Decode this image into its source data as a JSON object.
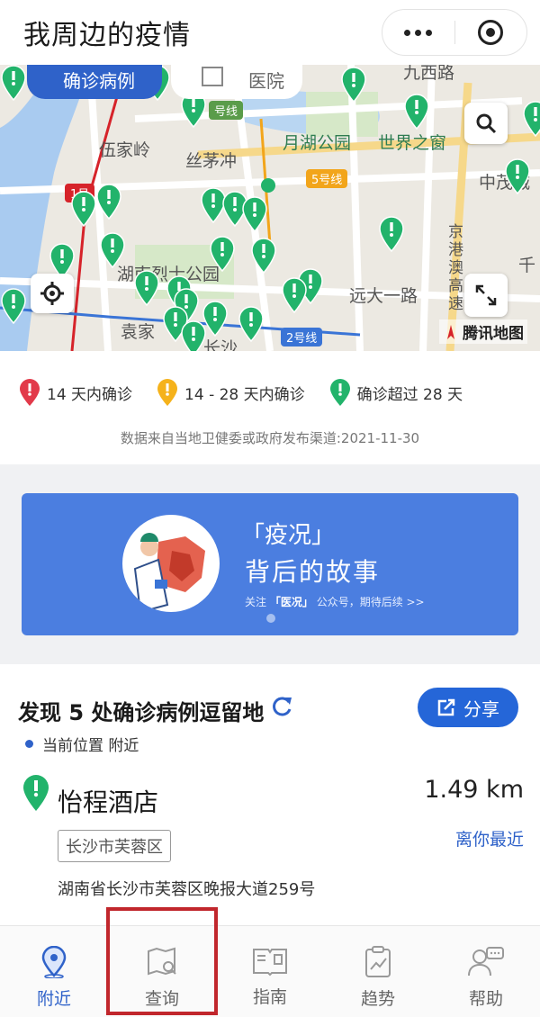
{
  "header": {
    "title": "我周边的疫情"
  },
  "map": {
    "tabs": {
      "cases": "确诊病例",
      "hospitals": "医院"
    },
    "labels": [
      "伍家岭",
      "丝茅冲",
      "月湖公园",
      "世界之窗",
      "中茂城",
      "湖南烈士公园",
      "远大一路",
      "袁家",
      "京港澳高速",
      "千",
      "九西路",
      "长沙",
      "5号线",
      "2号线",
      "1号",
      "号线"
    ],
    "logo_text": "腾讯地图",
    "colors": {
      "pin_green": "#22b36b",
      "pin_red": "#e23a4a",
      "pin_yellow": "#f5b21b"
    }
  },
  "legend": {
    "items": [
      {
        "label": "14 天内确诊",
        "color": "#e23a4a"
      },
      {
        "label": "14 - 28 天内确诊",
        "color": "#f5b21b"
      },
      {
        "label": "确诊超过 28 天",
        "color": "#22b36b"
      }
    ],
    "source": "数据来自当地卫健委或政府发布渠道:2021-11-30"
  },
  "banner": {
    "title": "「疫况」",
    "subtitle": "背后的故事",
    "note_prefix": "关注",
    "note_highlight": "「医况」",
    "note_suffix": "公众号，期待后续 >>"
  },
  "cases": {
    "title": "发现 5 处确诊病例逗留地",
    "share_label": "分享",
    "location": "当前位置 附近",
    "place": {
      "name": "怡程酒店",
      "distance": "1.49 km",
      "district": "长沙市芙蓉区",
      "tag": "离你最近",
      "address": "湖南省长沙市芙蓉区晚报大道259号"
    }
  },
  "nav": {
    "items": [
      {
        "label": "附近",
        "icon": "location-pin-icon",
        "active": true
      },
      {
        "label": "查询",
        "icon": "map-search-icon"
      },
      {
        "label": "指南",
        "icon": "book-icon"
      },
      {
        "label": "趋势",
        "icon": "clipboard-chart-icon"
      },
      {
        "label": "帮助",
        "icon": "chat-person-icon"
      }
    ]
  }
}
